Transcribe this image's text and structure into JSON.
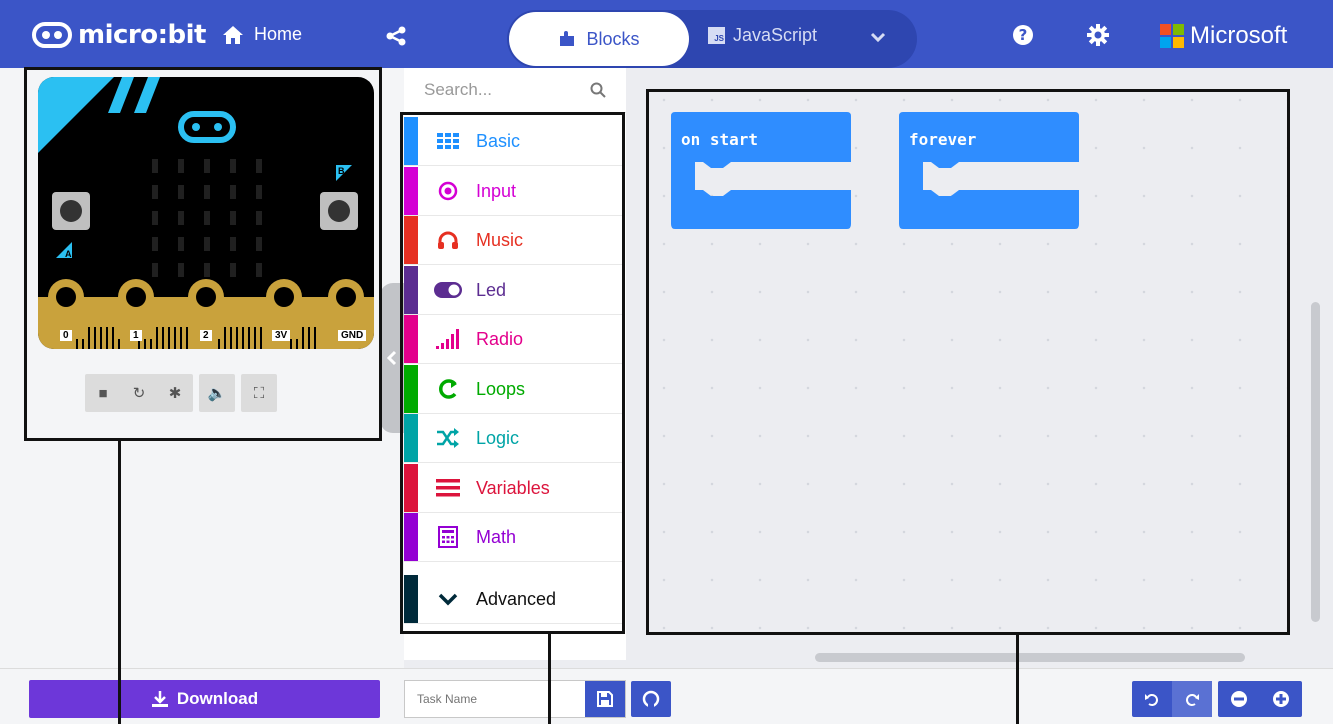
{
  "header": {
    "logo_text": "micro:bit",
    "home_label": "Home",
    "tabs": [
      {
        "label": "Blocks",
        "active": true
      },
      {
        "label": "JavaScript",
        "badge": "JS",
        "active": false
      }
    ],
    "brand": "Microsoft"
  },
  "simulator": {
    "pins": [
      "0",
      "1",
      "2",
      "3V",
      "GND"
    ],
    "buttons": [
      "A",
      "B"
    ],
    "controls": [
      "stop-icon",
      "restart-icon",
      "debug-icon",
      "sound-icon",
      "fullscreen-icon"
    ]
  },
  "toolbox": {
    "search_placeholder": "Search...",
    "categories": [
      {
        "label": "Basic",
        "color": "#1e90ff",
        "icon": "grid-icon"
      },
      {
        "label": "Input",
        "color": "#d400d4",
        "icon": "target-icon"
      },
      {
        "label": "Music",
        "color": "#e63022",
        "icon": "headphones-icon"
      },
      {
        "label": "Led",
        "color": "#5c2d91",
        "icon": "toggle-icon"
      },
      {
        "label": "Radio",
        "color": "#e3008c",
        "icon": "signal-icon"
      },
      {
        "label": "Loops",
        "color": "#00aa00",
        "icon": "loop-icon"
      },
      {
        "label": "Logic",
        "color": "#00a4a6",
        "icon": "shuffle-icon"
      },
      {
        "label": "Variables",
        "color": "#dc143c",
        "icon": "lines-icon"
      },
      {
        "label": "Math",
        "color": "#9400d3",
        "icon": "calculator-icon"
      },
      {
        "label": "Advanced",
        "color": "#002a3a",
        "icon": "chevron-down-icon"
      }
    ]
  },
  "workspace": {
    "blocks": [
      {
        "label": "on start",
        "color": "#2f8dff"
      },
      {
        "label": "forever",
        "color": "#2f8dff"
      }
    ]
  },
  "footer": {
    "download_label": "Download",
    "task_placeholder": "Task Name"
  },
  "colors": {
    "header": "#3b55c7",
    "download": "#6d37d9",
    "board_accent": "#2bc0f2",
    "edge_gold": "#c9a23c"
  }
}
